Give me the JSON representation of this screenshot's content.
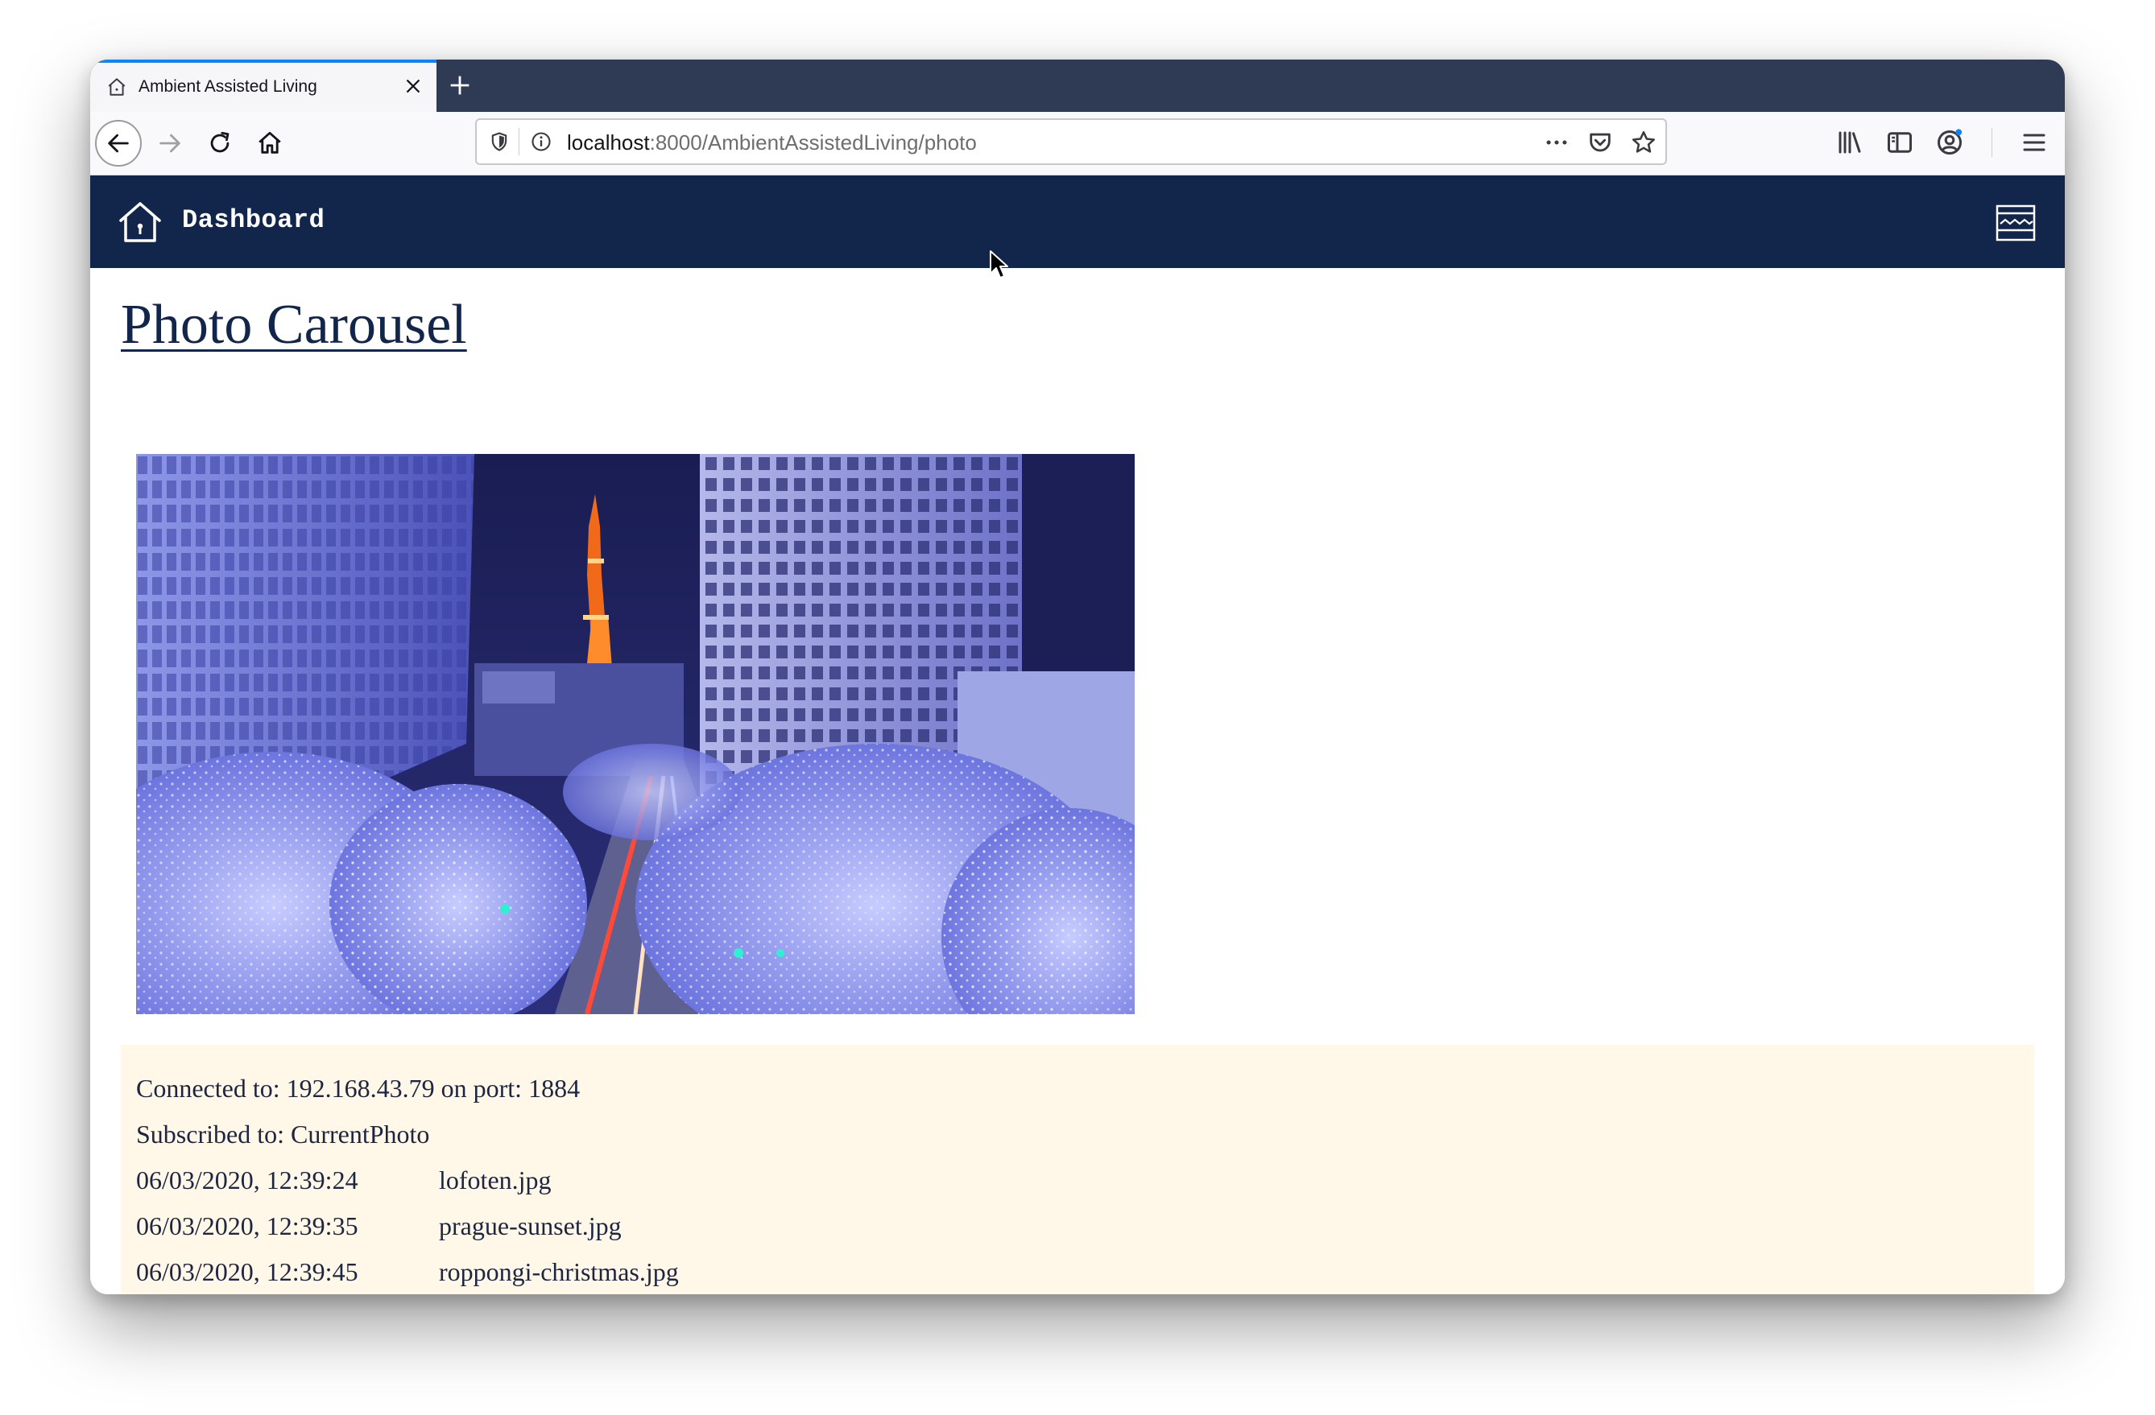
{
  "browser": {
    "tab_title": "Ambient Assisted Living",
    "url_host": "localhost",
    "url_path": ":8000/AmbientAssistedLiving/photo"
  },
  "app": {
    "brand": "Dashboard",
    "colors": {
      "nav_bg": "#12254a",
      "log_bg": "#fff8e8",
      "tab_accent": "#0a84ff"
    }
  },
  "page": {
    "heading": "Photo Carousel"
  },
  "log": {
    "connected": "Connected to: 192.168.43.79 on port: 1884",
    "subscribed": "Subscribed to: CurrentPhoto",
    "entries": [
      {
        "time": "06/03/2020, 12:39:24",
        "file": "lofoten.jpg"
      },
      {
        "time": "06/03/2020, 12:39:35",
        "file": "prague-sunset.jpg"
      },
      {
        "time": "06/03/2020, 12:39:45",
        "file": "roppongi-christmas.jpg"
      }
    ]
  }
}
